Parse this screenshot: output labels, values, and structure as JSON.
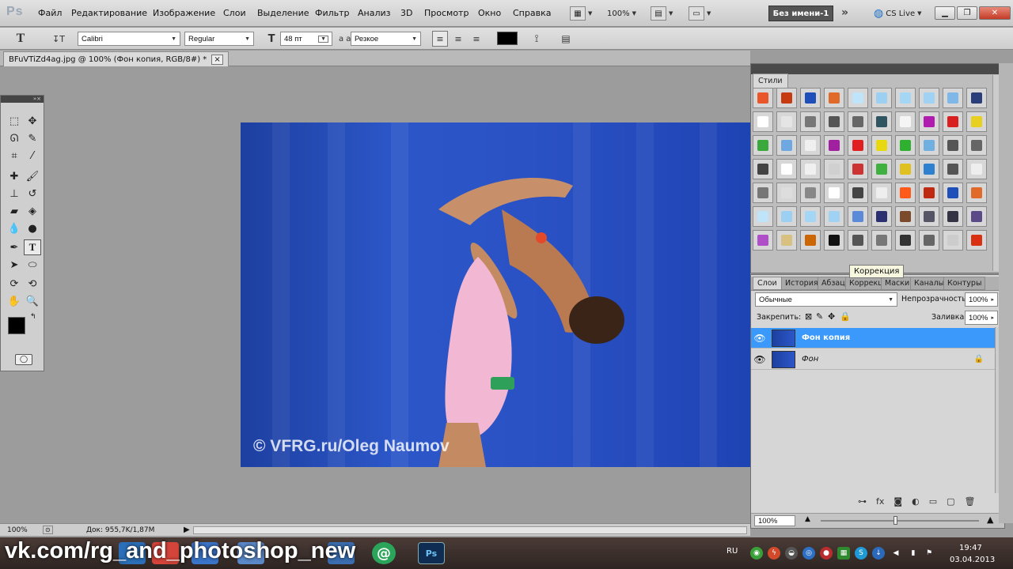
{
  "app": {
    "logo": "Ps",
    "doc_window_name": "Без имени-1",
    "cs_live": "CS Live",
    "zoom_menu": "100%"
  },
  "menu": [
    "Файл",
    "Редактирование",
    "Изображение",
    "Слои",
    "Выделение",
    "Фильтр",
    "Анализ",
    "3D",
    "Просмотр",
    "Окно",
    "Справка"
  ],
  "options": {
    "font_family": "Calibri",
    "font_style": "Regular",
    "font_size": "48 пт",
    "aa_label": "a a",
    "antialias": "Резкое",
    "text_color": "#000000"
  },
  "document": {
    "tab_title": "BFuVTiZd4ag.jpg @ 100% (Фон копия, RGB/8#) *",
    "close": "×",
    "watermark": "© VFRG.ru/Oleg Naumov"
  },
  "status": {
    "zoom": "100%",
    "doc_info": "Док: 955,7K/1,87M"
  },
  "panels": {
    "styles_tab": "Стили",
    "tooltip": "Коррекция",
    "layer_tabs": [
      "Слои",
      "История",
      "Абзац",
      "Коррекц",
      "Маски",
      "Каналы",
      "Контуры"
    ],
    "blend_mode": "Обычные",
    "opacity_label": "Непрозрачность:",
    "opacity": "100%",
    "lock_label": "Закрепить:",
    "fill_label": "Заливка:",
    "fill": "100%",
    "layers": [
      {
        "name": "Фон копия",
        "selected": true
      },
      {
        "name": "Фон",
        "locked": true
      }
    ],
    "zoom": "100%"
  },
  "taskbar": {
    "overlay_text": "vk.com/rg_and_photoshop_new",
    "lang": "RU",
    "time": "19:47",
    "date": "03.04.2013"
  },
  "colors": {
    "selection": "#3b99fc",
    "foreground": "#000000",
    "background": "#ffffff"
  }
}
